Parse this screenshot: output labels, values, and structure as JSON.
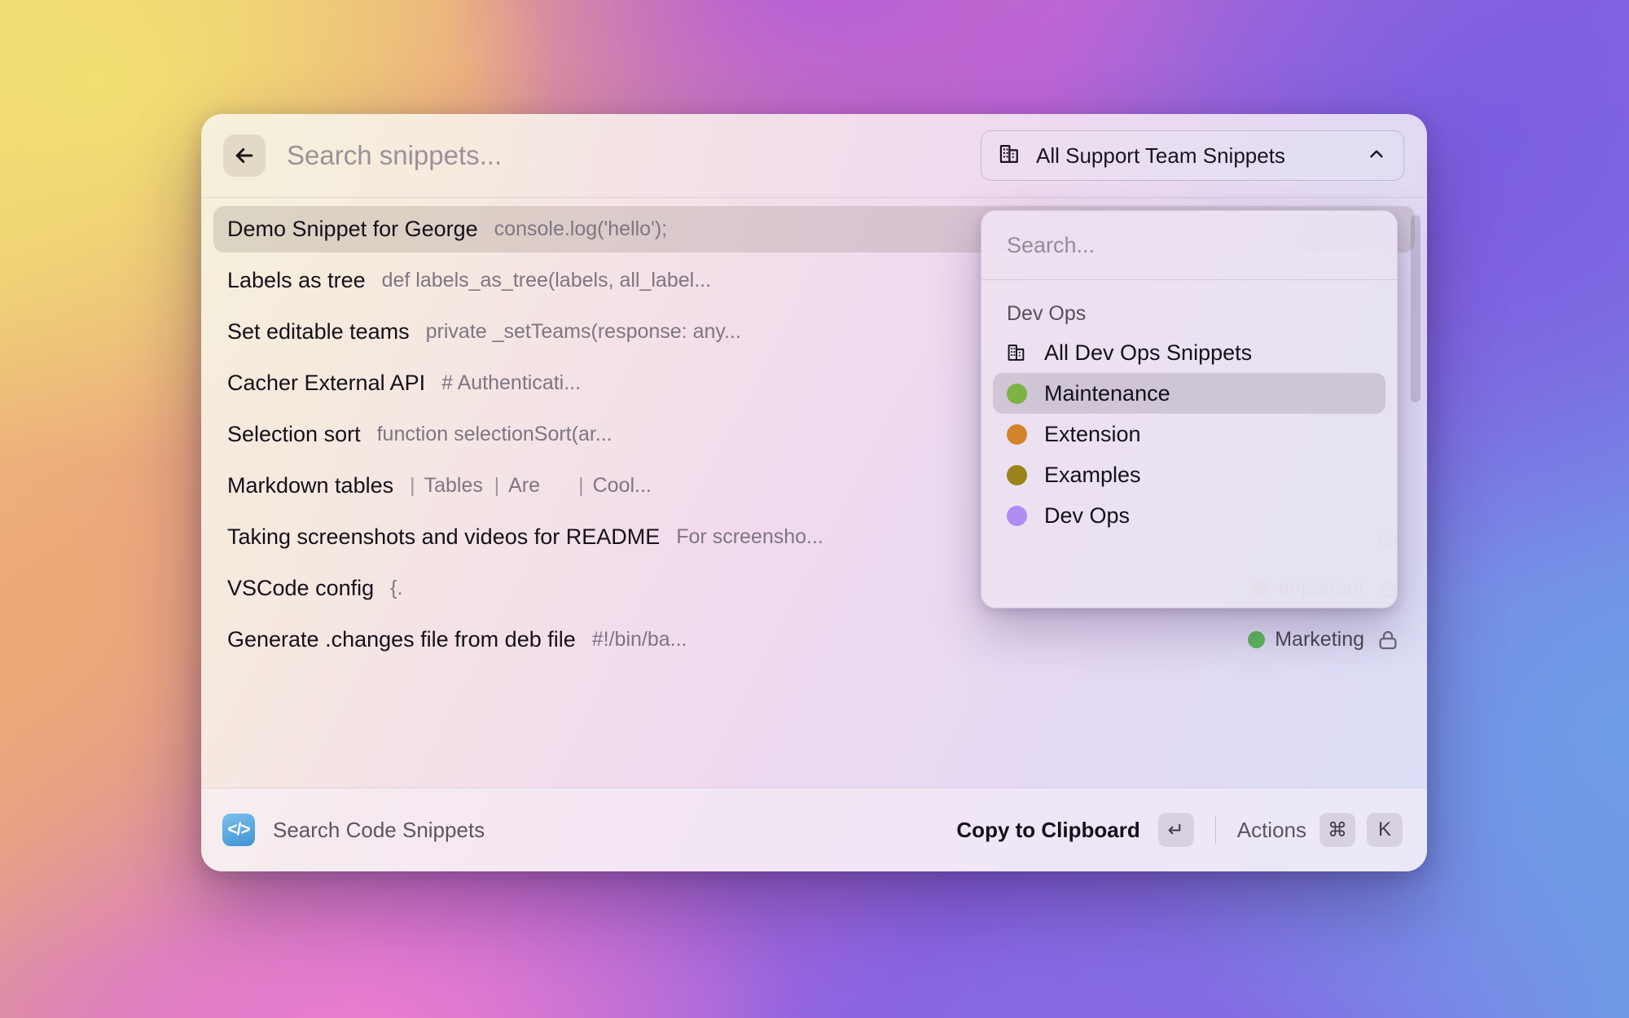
{
  "header": {
    "back_icon": "arrow-left-icon",
    "search_placeholder": "Search snippets...",
    "search_value": "",
    "scope": {
      "icon": "building-icon",
      "label": "All Support Team Snippets",
      "chevron": "chevron-up-icon"
    }
  },
  "list": {
    "rows": [
      {
        "title": "Demo Snippet for George",
        "preview": "console.log('hello');",
        "selected": true,
        "label": null,
        "locked": false
      },
      {
        "title": "Labels as tree",
        "preview": "def labels_as_tree(labels, all_label...",
        "selected": false,
        "label": null,
        "locked": false
      },
      {
        "title": "Set editable teams",
        "preview": "private _setTeams(response: any...",
        "selected": false,
        "label": null,
        "locked": false
      },
      {
        "title": "Cacher External API",
        "preview": "# Authenticati...",
        "selected": false,
        "label": null,
        "locked": false
      },
      {
        "title": "Selection sort",
        "preview": "function selectionSort(ar...",
        "selected": false,
        "label": null,
        "locked": false
      },
      {
        "title": "Markdown tables",
        "preview": "| Tables      | Are      | Cool...",
        "table_cells": [
          "Tables",
          "Are",
          "Cool..."
        ],
        "selected": false,
        "label": null,
        "locked": false
      },
      {
        "title": "Taking screenshots and videos for README",
        "preview": "For screensho...",
        "selected": false,
        "label": null,
        "locked": true
      },
      {
        "title": "VSCode config",
        "preview": "{.",
        "selected": false,
        "label": {
          "text": "Important",
          "color": "#9a8419"
        },
        "locked": true
      },
      {
        "title": "Generate .changes file from deb file",
        "preview": "#!/bin/ba...",
        "selected": false,
        "label": {
          "text": "Marketing",
          "color": "#5cb85c"
        },
        "locked": true
      }
    ]
  },
  "dropdown": {
    "search_placeholder": "Search...",
    "search_value": "",
    "section_title": "Dev Ops",
    "items": [
      {
        "label": "All Dev Ops Snippets",
        "icon": "building-icon",
        "color": null,
        "active": false
      },
      {
        "label": "Maintenance",
        "icon": "dot",
        "color": "#7cb342",
        "active": true
      },
      {
        "label": "Extension",
        "icon": "dot",
        "color": "#d2832a",
        "active": false
      },
      {
        "label": "Examples",
        "icon": "dot",
        "color": "#9a8419",
        "active": false
      },
      {
        "label": "Dev Ops",
        "icon": "dot",
        "color": "#b18cf5",
        "active": false
      }
    ]
  },
  "footer": {
    "app_icon": "code-icon",
    "app_icon_glyph": "</>",
    "app_name": "Search Code Snippets",
    "primary_action": "Copy to Clipboard",
    "primary_key": "↵",
    "secondary_action": "Actions",
    "secondary_keys": [
      "⌘",
      "K"
    ]
  }
}
